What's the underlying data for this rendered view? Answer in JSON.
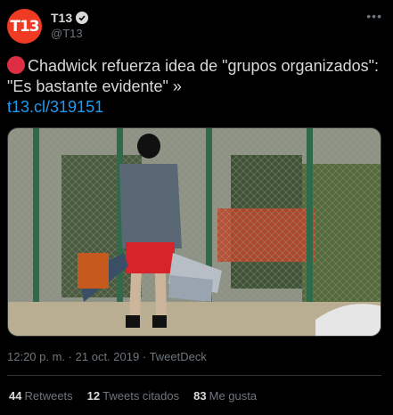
{
  "account": {
    "avatar_text": "T13",
    "display_name": "T13",
    "handle": "@T13",
    "verified": true,
    "brand_color": "#ef3b24"
  },
  "tweet": {
    "text": "Chadwick refuerza idea de \"grupos organizados\": \"Es bastante evidente\" »",
    "link": "t13.cl/319151",
    "time": "12:20 p. m.",
    "date": "21 oct. 2019",
    "separator": "·",
    "source": "TweetDeck"
  },
  "stats": {
    "retweets_count": "44",
    "retweets_label": "Retweets",
    "quotes_count": "12",
    "quotes_label": "Tweets citados",
    "likes_count": "83",
    "likes_label": "Me gusta"
  },
  "icons": {
    "more": "more-icon",
    "verified": "verified-icon",
    "red_circle": "red-circle-emoji"
  },
  "colors": {
    "background": "#000000",
    "text": "#d9d9d9",
    "muted": "#6e767d",
    "link": "#1d9bf0"
  }
}
